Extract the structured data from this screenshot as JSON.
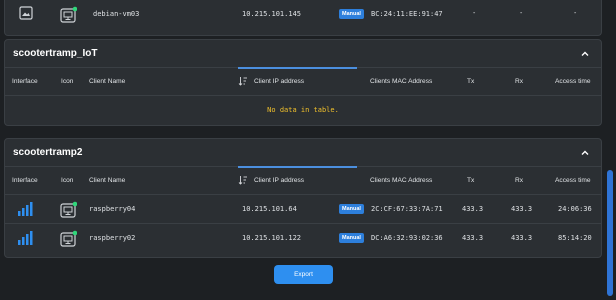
{
  "top_row": {
    "client_name": "debian-vm03",
    "ip": "10.215.101.145",
    "ip_type": "Manual",
    "mac": "BC:24:11:EE:91:47",
    "tx": "-",
    "rx": "-",
    "access_time": "-"
  },
  "columns": {
    "interface": "Interface",
    "icon": "Icon",
    "client_name": "Client Name",
    "client_ip": "Client IP address",
    "clients_mac": "Clients MAC Address",
    "tx": "Tx",
    "rx": "Rx",
    "access_time": "Access time"
  },
  "sections": [
    {
      "title": "scootertramp_IoT",
      "empty_text": "No data in table."
    },
    {
      "title": "scootertramp2",
      "rows": [
        {
          "client_name": "raspberry04",
          "ip": "10.215.101.64",
          "ip_type": "Manual",
          "mac": "2C:CF:67:33:7A:71",
          "tx": "433.3",
          "rx": "433.3",
          "access_time": "24:06:36"
        },
        {
          "client_name": "raspberry02",
          "ip": "10.215.101.122",
          "ip_type": "Manual",
          "mac": "DC:A6:32:93:02:36",
          "tx": "433.3",
          "rx": "433.3",
          "access_time": "85:14:20"
        }
      ]
    }
  ],
  "export_label": "Export",
  "icons": {
    "interface": "wifi-signal-icon",
    "device": "monitor-device-icon",
    "online": "online-dot-icon",
    "collapse": "chevron-up-icon",
    "sort": "sort-icon"
  },
  "colors": {
    "accent": "#2e8ff0",
    "badge": "#2d7fdc",
    "online": "#2fd67a",
    "empty_text": "#f0c02c"
  }
}
